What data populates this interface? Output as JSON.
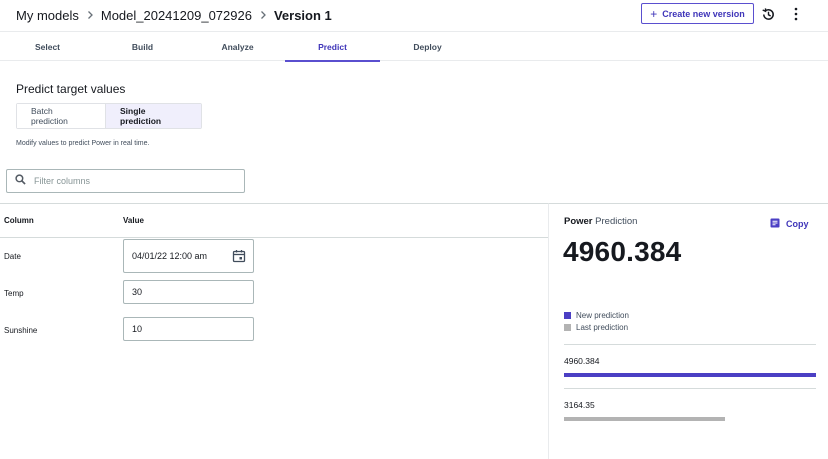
{
  "breadcrumb": {
    "root": "My models",
    "model": "Model_20241209_072926",
    "version": "Version 1"
  },
  "header": {
    "create_version_label": "Create new version"
  },
  "tabs": [
    {
      "label": "Select",
      "active": false
    },
    {
      "label": "Build",
      "active": false
    },
    {
      "label": "Analyze",
      "active": false
    },
    {
      "label": "Predict",
      "active": true
    },
    {
      "label": "Deploy",
      "active": false
    }
  ],
  "predict": {
    "title": "Predict target values",
    "mode_batch": "Batch prediction",
    "mode_single": "Single prediction",
    "hint": "Modify values to predict Power in real time.",
    "filter_placeholder": "Filter columns"
  },
  "table": {
    "col_column": "Column",
    "col_value": "Value",
    "rows": [
      {
        "column": "Date",
        "value": "04/01/22 12:00 am"
      },
      {
        "column": "Temp",
        "value": "30"
      },
      {
        "column": "Sunshine",
        "value": "10"
      }
    ]
  },
  "panel": {
    "target": "Power",
    "title_suffix": "Prediction",
    "copy_label": "Copy",
    "prediction_value": "4960.384",
    "legend_new": "New prediction",
    "legend_last": "Last prediction",
    "new_value": "4960.384",
    "last_value": "3164.35",
    "new_fraction": 1.0,
    "last_fraction": 0.638
  },
  "colors": {
    "accent": "#5a4fcf",
    "new_bar": "#4b3fc4",
    "last_bar": "#b3b3b3"
  }
}
